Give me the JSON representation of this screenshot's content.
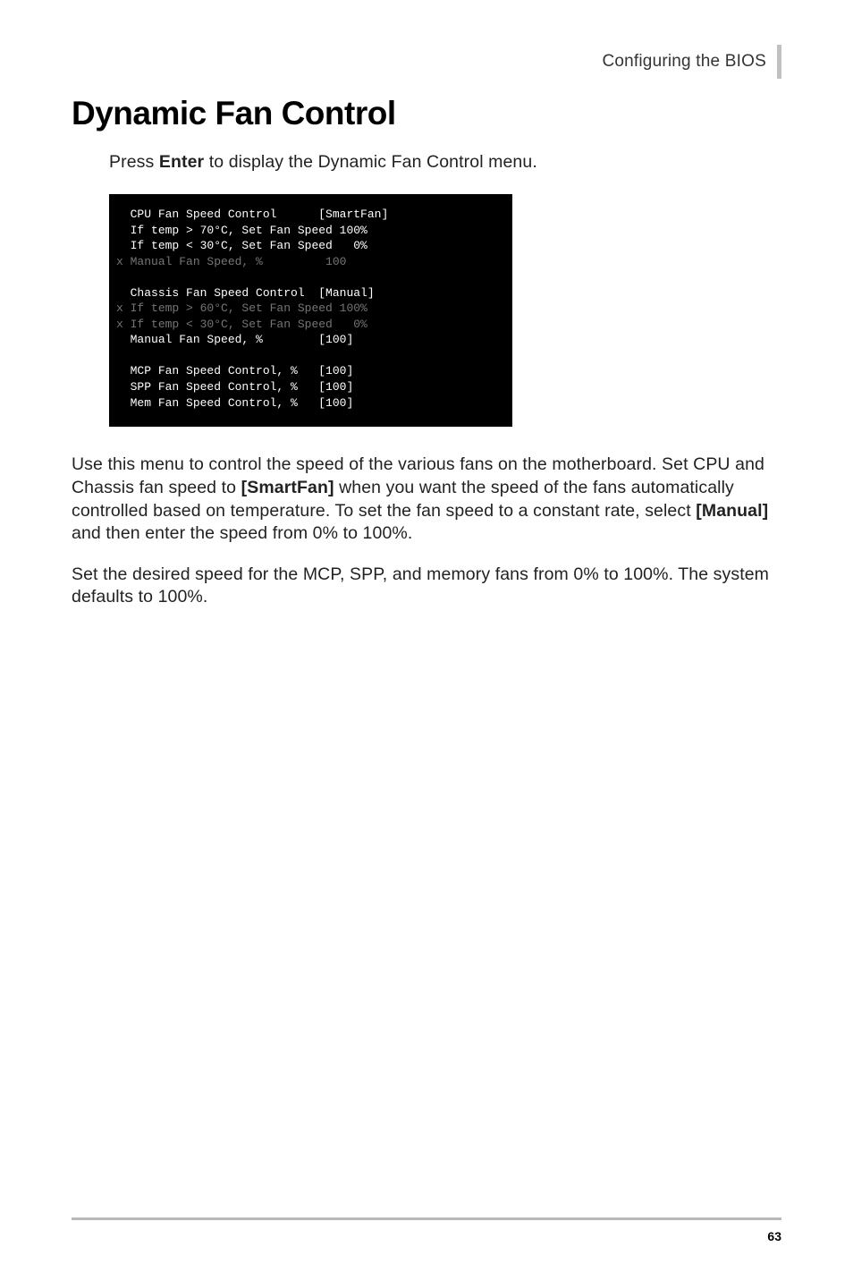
{
  "header": {
    "section": "Configuring the BIOS"
  },
  "title": "Dynamic Fan Control",
  "intro": {
    "prefix": "Press ",
    "bold": "Enter",
    "suffix": " to display the Dynamic Fan Control menu."
  },
  "bios": {
    "lines": [
      {
        "prefix": "  ",
        "grey": false,
        "text": "CPU Fan Speed Control      [SmartFan]"
      },
      {
        "prefix": "  ",
        "grey": false,
        "text": "If temp > 70°C, Set Fan Speed 100%"
      },
      {
        "prefix": "  ",
        "grey": false,
        "text": "If temp < 30°C, Set Fan Speed   0%"
      },
      {
        "prefix": "x ",
        "grey": true,
        "text": "Manual Fan Speed, %         100"
      },
      {
        "prefix": "",
        "grey": false,
        "text": ""
      },
      {
        "prefix": "  ",
        "grey": false,
        "text": "Chassis Fan Speed Control  [Manual]"
      },
      {
        "prefix": "x ",
        "grey": true,
        "text": "If temp > 60°C, Set Fan Speed 100%"
      },
      {
        "prefix": "x ",
        "grey": true,
        "text": "If temp < 30°C, Set Fan Speed   0%"
      },
      {
        "prefix": "  ",
        "grey": false,
        "text": "Manual Fan Speed, %        [100]"
      },
      {
        "prefix": "",
        "grey": false,
        "text": ""
      },
      {
        "prefix": "  ",
        "grey": false,
        "text": "MCP Fan Speed Control, %   [100]"
      },
      {
        "prefix": "  ",
        "grey": false,
        "text": "SPP Fan Speed Control, %   [100]"
      },
      {
        "prefix": "  ",
        "grey": false,
        "text": "Mem Fan Speed Control, %   [100]"
      }
    ]
  },
  "paragraph1": {
    "p1": "Use this menu to control the speed of the various fans on the motherboard. Set CPU and Chassis fan speed to ",
    "b1": "[SmartFan]",
    "p2": " when you want the speed of the fans automatically controlled based on temperature. To set the fan speed to a constant rate, select ",
    "b2": "[Manual]",
    "p3": " and then enter the speed from 0% to 100%."
  },
  "paragraph2": "Set the desired speed for the MCP, SPP, and memory fans from 0% to 100%. The system defaults to 100%.",
  "footer": {
    "page": "63"
  }
}
